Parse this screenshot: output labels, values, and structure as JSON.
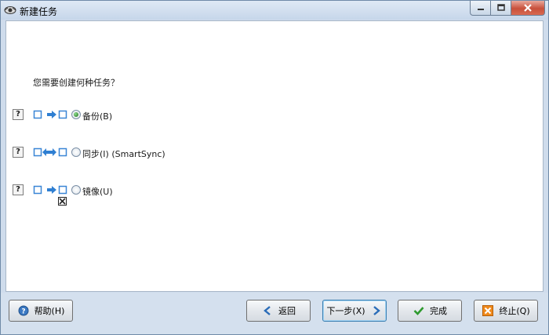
{
  "window": {
    "title": "新建任务"
  },
  "main": {
    "question": "您需要创建何种任务？",
    "options": [
      {
        "label": "备份(B)",
        "help": "?",
        "selected": true,
        "diagram": "backup"
      },
      {
        "label": "同步(I) (SmartSync)",
        "help": "?",
        "selected": false,
        "diagram": "sync"
      },
      {
        "label": "镜像(U)",
        "help": "?",
        "selected": false,
        "diagram": "mirror"
      }
    ]
  },
  "buttons": {
    "help": "帮助(H)",
    "back": "返回",
    "next": "下一步(X)",
    "finish": "完成",
    "cancel": "终止(Q)"
  },
  "colors": {
    "arrow": "#2f7fd2",
    "box": "#3a86d6",
    "finish_check": "#2e9a2e",
    "cancel_icon": "#f08a1c"
  }
}
